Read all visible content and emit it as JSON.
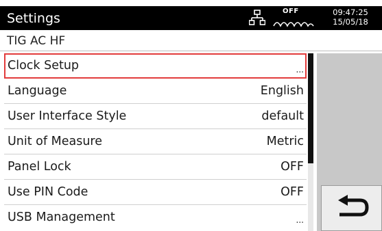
{
  "header": {
    "title": "Settings",
    "network_icon": "network-icon",
    "off_label": "OFF",
    "time": "09:47:25",
    "date": "15/05/18"
  },
  "mode": "TIG AC HF",
  "menu": {
    "items": [
      {
        "label": "Clock Setup",
        "value": "...",
        "selected": true
      },
      {
        "label": "Language",
        "value": "English"
      },
      {
        "label": "User Interface Style",
        "value": "default"
      },
      {
        "label": "Unit of Measure",
        "value": "Metric"
      },
      {
        "label": "Panel Lock",
        "value": "OFF"
      },
      {
        "label": "Use PIN Code",
        "value": "OFF"
      },
      {
        "label": "USB Management",
        "value": "..."
      }
    ]
  },
  "scroll": {
    "visible_fraction": 0.62,
    "position": 0
  },
  "back_button": {
    "icon": "return-arrow-icon"
  },
  "colors": {
    "header_bg": "#000000",
    "selection_border": "#e23b3b",
    "panel_bg": "#c8c8c8"
  }
}
